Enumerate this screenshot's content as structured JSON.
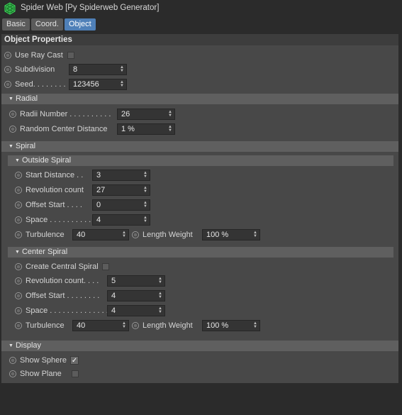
{
  "window": {
    "title": "Spider Web [Py Spiderweb Generator]"
  },
  "tabs": [
    {
      "label": "Basic"
    },
    {
      "label": "Coord."
    },
    {
      "label": "Object"
    }
  ],
  "header": {
    "title": "Object Properties"
  },
  "object": {
    "use_ray_cast": {
      "label": "Use Ray Cast",
      "checked": false
    },
    "subdivision": {
      "label": "Subdivision",
      "value": "8"
    },
    "seed": {
      "label": "Seed. . . . . . . .",
      "value": "123456"
    }
  },
  "radial": {
    "title": "Radial",
    "radii_number": {
      "label": "Radii Number  . . . . . . . . . .",
      "value": "26"
    },
    "random_center_distance": {
      "label": "Random Center Distance",
      "value": "1 %"
    }
  },
  "spiral": {
    "title": "Spiral",
    "outside": {
      "title": "Outside Spiral",
      "start_distance": {
        "label": "Start Distance . .",
        "value": "3"
      },
      "revolution_count": {
        "label": "Revolution count",
        "value": "27"
      },
      "offset_start": {
        "label": "Offset Start . . . .",
        "value": "0"
      },
      "space": {
        "label": "Space . . . . . . . . . .",
        "value": "4"
      },
      "turbulence": {
        "label": "Turbulence",
        "value": "40"
      },
      "length_weight": {
        "label": "Length Weight",
        "value": "100 %"
      }
    },
    "center": {
      "title": "Center Spiral",
      "create_central_spiral": {
        "label": "Create Central Spiral",
        "checked": false
      },
      "revolution_count": {
        "label": "Revolution count. . . .",
        "value": "5"
      },
      "offset_start": {
        "label": "Offset Start . . . . . . . .",
        "value": "4"
      },
      "space": {
        "label": "Space . . . . . . . . . . . . . .",
        "value": "4"
      },
      "turbulence": {
        "label": "Turbulence",
        "value": "40"
      },
      "length_weight": {
        "label": "Length Weight",
        "value": "100 %"
      }
    }
  },
  "display": {
    "title": "Display",
    "show_sphere": {
      "label": "Show Sphere",
      "checked": true,
      "mark": "✓"
    },
    "show_plane": {
      "label": "Show Plane",
      "checked": false
    }
  },
  "colors": {
    "accent": "#4f80b8",
    "panel": "#484848",
    "section": "#5f5f5f"
  }
}
